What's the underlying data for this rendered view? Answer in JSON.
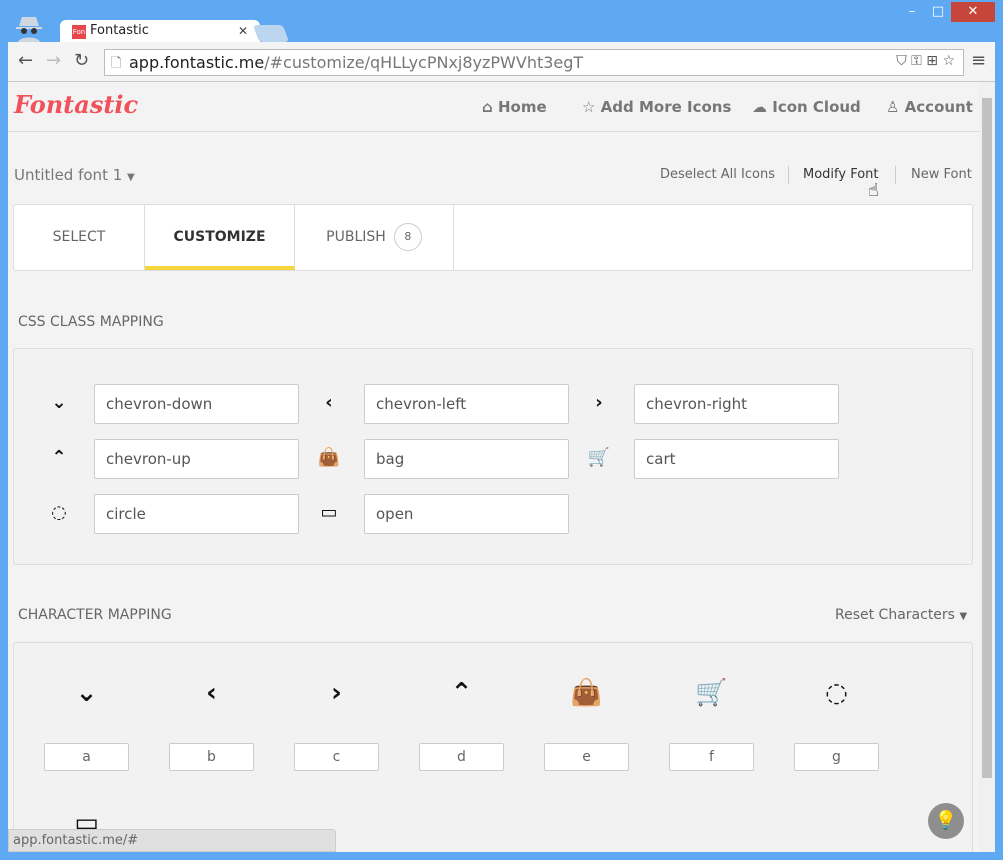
{
  "browser": {
    "tab_title": "Fontastic",
    "url_host": "app.fontastic.me",
    "url_path": "/#customize/qHLLycPNxj8yzPWVht3egT",
    "status_url": "app.fontastic.me/#"
  },
  "header": {
    "logo": "Fontastic",
    "menu": [
      {
        "label": "Home",
        "icon": "home-icon"
      },
      {
        "label": "Add More Icons",
        "icon": "star-icon"
      },
      {
        "label": "Icon Cloud",
        "icon": "cloud-icon"
      },
      {
        "label": "Account",
        "icon": "user-icon"
      }
    ]
  },
  "font": {
    "name": "Untitled font 1",
    "actions": [
      "Deselect All Icons",
      "Modify Font",
      "New Font"
    ]
  },
  "tabs": [
    {
      "label": "SELECT"
    },
    {
      "label": "CUSTOMIZE",
      "active": true
    },
    {
      "label": "PUBLISH",
      "badge": "8"
    }
  ],
  "css_mapping": {
    "title": "CSS CLASS MAPPING",
    "items": [
      {
        "glyph": "⌄",
        "value": "chevron-down"
      },
      {
        "glyph": "‹",
        "value": "chevron-left"
      },
      {
        "glyph": "›",
        "value": "chevron-right"
      },
      {
        "glyph": "⌃",
        "value": "chevron-up"
      },
      {
        "glyph": "👜",
        "value": "bag"
      },
      {
        "glyph": "🛒",
        "value": "cart"
      },
      {
        "glyph": "◌",
        "value": "circle"
      },
      {
        "glyph": "▭",
        "value": "open"
      }
    ]
  },
  "char_mapping": {
    "title": "CHARACTER MAPPING",
    "reset": "Reset Characters",
    "items": [
      {
        "glyph": "⌄",
        "char": "a"
      },
      {
        "glyph": "‹",
        "char": "b"
      },
      {
        "glyph": "›",
        "char": "c"
      },
      {
        "glyph": "⌃",
        "char": "d"
      },
      {
        "glyph": "👜",
        "char": "e"
      },
      {
        "glyph": "🛒",
        "char": "f"
      },
      {
        "glyph": "◌",
        "char": "g"
      }
    ]
  },
  "accent": "#f5d63d",
  "brand": "#f0515a"
}
